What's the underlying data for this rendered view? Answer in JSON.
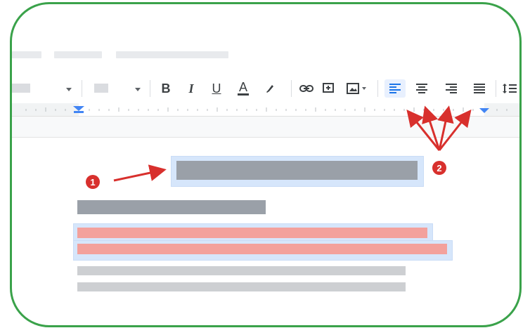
{
  "toolbar": {
    "bold_glyph": "B",
    "italic_glyph": "I",
    "underline_glyph": "U",
    "text_color_glyph": "A",
    "icons": [
      "caret-down-icon",
      "bold-icon",
      "italic-icon",
      "underline-icon",
      "text-color-icon",
      "highlighter-icon",
      "link-icon",
      "add-comment-icon",
      "insert-image-icon",
      "align-left-icon",
      "align-center-icon",
      "align-right-icon",
      "justify-icon",
      "line-spacing-icon"
    ],
    "active_button": "align-left"
  },
  "annotations": {
    "badge_1": "1",
    "badge_2": "2"
  },
  "colors": {
    "frame_border": "#3aa24a",
    "arrow": "#d8302d",
    "selected_highlight": "#d6e6fb",
    "title_placeholder": "#9aa0a8",
    "red_placeholder": "#f3a19c",
    "gray_placeholder": "#cdcfd2",
    "ruler_marker": "#4285f4"
  }
}
